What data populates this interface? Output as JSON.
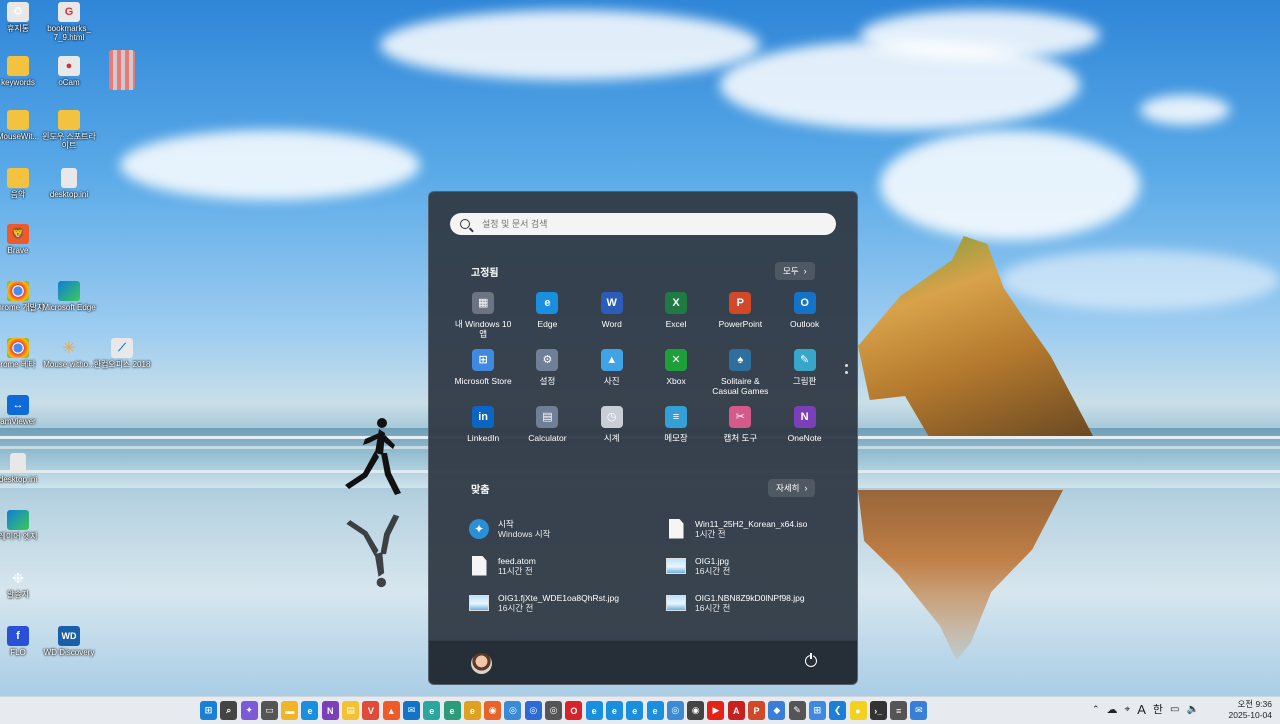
{
  "desktop": {
    "icons": [
      {
        "label": "휴지통",
        "icon": "recycle-bin-icon"
      },
      {
        "label": "bookmarks_ 7_9.html",
        "icon": "html-file-icon"
      },
      {
        "label": "keywords",
        "icon": "folder-icon"
      },
      {
        "label": "oCam",
        "icon": "ocam-icon"
      },
      {
        "label": "",
        "icon": "blurred-icon"
      },
      {
        "label": "MouseWit...",
        "icon": "folder-icon"
      },
      {
        "label": "윈도우 스포트라이트",
        "icon": "folder-icon"
      },
      {
        "label": "음악",
        "icon": "folder-icon"
      },
      {
        "label": "desktop.ini",
        "icon": "file-icon"
      },
      {
        "label": "Brave",
        "icon": "brave-icon"
      },
      {
        "label": "Chrome 개발자",
        "icon": "chrome-icon"
      },
      {
        "label": "Microsoft Edge",
        "icon": "edge-icon"
      },
      {
        "label": "rome 베타",
        "icon": "chrome-icon"
      },
      {
        "label": "Mouse witho...",
        "icon": "mouse-icon"
      },
      {
        "label": "한컴오피스 2018",
        "icon": "hancom-icon"
      },
      {
        "label": "amViewer",
        "icon": "teamviewer-icon"
      },
      {
        "label": "desktop.ini",
        "icon": "file-icon"
      },
      {
        "label": "레이어 엣지",
        "icon": "edge-icon"
      },
      {
        "label": "알송지",
        "icon": "app-icon"
      },
      {
        "label": "FLO",
        "icon": "flo-icon"
      },
      {
        "label": "WD Discovery",
        "icon": "wd-icon"
      }
    ]
  },
  "start_menu": {
    "search_placeholder": "설정 및 문서 검색",
    "pinned_title": "고정됨",
    "pinned_all_label": "모두",
    "pinned_apps": [
      {
        "label": "내 Windows 10 앱",
        "icon": "windows10-apps-icon",
        "color": "#6b7480"
      },
      {
        "label": "Edge",
        "icon": "edge-icon",
        "color": "#1a8fe0"
      },
      {
        "label": "Word",
        "icon": "word-icon",
        "color": "#2b5cb8"
      },
      {
        "label": "Excel",
        "icon": "excel-icon",
        "color": "#1f7a44"
      },
      {
        "label": "PowerPoint",
        "icon": "powerpoint-icon",
        "color": "#d2492a"
      },
      {
        "label": "Outlook",
        "icon": "outlook-icon",
        "color": "#1573c7"
      },
      {
        "label": "Microsoft Store",
        "icon": "store-icon",
        "color": "#3f8ae0"
      },
      {
        "label": "설정",
        "icon": "gear-icon",
        "color": "#6f7f95"
      },
      {
        "label": "사진",
        "icon": "photos-icon",
        "color": "#3fa3e6"
      },
      {
        "label": "Xbox",
        "icon": "xbox-icon",
        "color": "#1f9e3c"
      },
      {
        "label": "Solitaire & Casual Games",
        "icon": "solitaire-icon",
        "color": "#2e6f9e"
      },
      {
        "label": "그림판",
        "icon": "paint-icon",
        "color": "#38a6c8"
      },
      {
        "label": "LinkedIn",
        "icon": "linkedin-icon",
        "color": "#0a66c2"
      },
      {
        "label": "Calculator",
        "icon": "calculator-icon",
        "color": "#6f7f95"
      },
      {
        "label": "시계",
        "icon": "clock-icon",
        "color": "#c9ced6"
      },
      {
        "label": "메모장",
        "icon": "notepad-icon",
        "color": "#35a0d8"
      },
      {
        "label": "캡처 도구",
        "icon": "snipping-tool-icon",
        "color": "#d45a8a"
      },
      {
        "label": "OneNote",
        "icon": "onenote-icon",
        "color": "#7b3fb8"
      }
    ],
    "recommended_title": "맞춤",
    "recommended_more_label": "자세히",
    "recommended": [
      {
        "name": "시작",
        "sub": "Windows 시작",
        "icon": "get-started-icon"
      },
      {
        "name": "Win11_25H2_Korean_x64.iso",
        "sub": "1시간 전",
        "icon": "document-icon"
      },
      {
        "name": "feed.atom",
        "sub": "11시간 전",
        "icon": "document-icon"
      },
      {
        "name": "OIG1.jpg",
        "sub": "16시간 전",
        "icon": "image-icon"
      },
      {
        "name": "OIG1.fjXte_WDE1oa8QhRst.jpg",
        "sub": "16시간 전",
        "icon": "image-icon"
      },
      {
        "name": "OIG1.NBN8Z9kD0lNPf98.jpg",
        "sub": "16시간 전",
        "icon": "image-icon"
      }
    ]
  },
  "taskbar": {
    "apps": [
      {
        "icon": "windows-start-icon",
        "color": "#1a7fd6"
      },
      {
        "icon": "search-icon",
        "color": "#444444"
      },
      {
        "icon": "copilot-icon",
        "color": "#7a5ad6"
      },
      {
        "icon": "task-view-icon",
        "color": "#555555"
      },
      {
        "icon": "explorer-icon",
        "color": "#f0b429"
      },
      {
        "icon": "edge-icon",
        "color": "#1a8fe0"
      },
      {
        "icon": "onenote-icon",
        "color": "#7b3fb8"
      },
      {
        "icon": "notes-icon",
        "color": "#f2c230"
      },
      {
        "icon": "vivaldi-icon",
        "color": "#e04b3a"
      },
      {
        "icon": "brave-icon",
        "color": "#f05a28"
      },
      {
        "icon": "mail-icon",
        "color": "#1573c7"
      },
      {
        "icon": "edge-beta-icon",
        "color": "#2aa8a0"
      },
      {
        "icon": "edge-dev-icon",
        "color": "#2b9c7a"
      },
      {
        "icon": "edge-canary-icon",
        "color": "#e0a020"
      },
      {
        "icon": "firefox-icon",
        "color": "#e8632a"
      },
      {
        "icon": "chrome-icon",
        "color": "#3b8ad6"
      },
      {
        "icon": "chrome-beta-icon",
        "color": "#2c6ad6"
      },
      {
        "icon": "chrome-dev-icon",
        "color": "#555555"
      },
      {
        "icon": "opera-icon",
        "color": "#d8232a"
      },
      {
        "icon": "edge-icon",
        "color": "#1a8fe0"
      },
      {
        "icon": "edge-icon",
        "color": "#1a8fe0"
      },
      {
        "icon": "edge-icon",
        "color": "#1a8fe0"
      },
      {
        "icon": "edge-icon",
        "color": "#1a8fe0"
      },
      {
        "icon": "chrome-icon",
        "color": "#3b8ad6"
      },
      {
        "icon": "camera-icon",
        "color": "#444444"
      },
      {
        "icon": "youtube-icon",
        "color": "#e62117"
      },
      {
        "icon": "acrobat-icon",
        "color": "#c8201e"
      },
      {
        "icon": "powerpoint-icon",
        "color": "#d2492a"
      },
      {
        "icon": "app-icon",
        "color": "#3a7fd6"
      },
      {
        "icon": "paint-icon",
        "color": "#555555"
      },
      {
        "icon": "store-icon",
        "color": "#3f8ae0"
      },
      {
        "icon": "vscode-icon",
        "color": "#1a7fd6"
      },
      {
        "icon": "kakaotalk-icon",
        "color": "#f2d21e"
      },
      {
        "icon": "terminal-icon",
        "color": "#333333"
      },
      {
        "icon": "notepad-icon",
        "color": "#555555"
      },
      {
        "icon": "chat-icon",
        "color": "#3a7fd6"
      }
    ],
    "tray": {
      "ime_mode": "A",
      "ime_lang": "한",
      "time": "오전 9:36",
      "date": "2025-10-04"
    }
  }
}
